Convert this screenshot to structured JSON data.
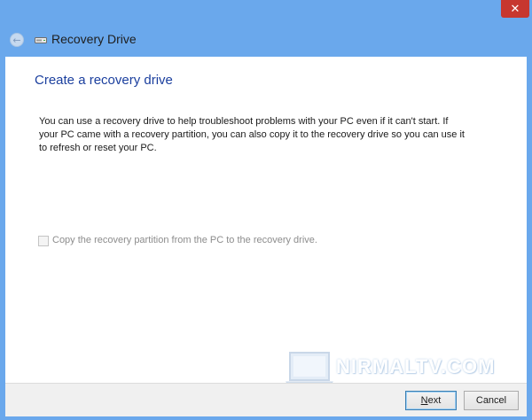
{
  "window": {
    "title": "Recovery Drive",
    "close_glyph": "✕",
    "back_glyph": "←",
    "frame_color": "#6aa8ec",
    "close_color": "#c7372f"
  },
  "main": {
    "heading": "Create a recovery drive",
    "heading_color": "#1b3f9e",
    "description": "You can use a recovery drive to help troubleshoot problems with your PC even if it can't start. If your PC came with a recovery partition, you can also copy it to the recovery drive so you can use it to refresh or reset your PC.",
    "checkbox": {
      "label": "Copy the recovery partition from the PC to the recovery drive.",
      "checked": false,
      "disabled": true
    }
  },
  "footer": {
    "next_label": "Next",
    "cancel_label": "Cancel"
  },
  "watermark": {
    "text": "NIRMALTV.COM"
  }
}
